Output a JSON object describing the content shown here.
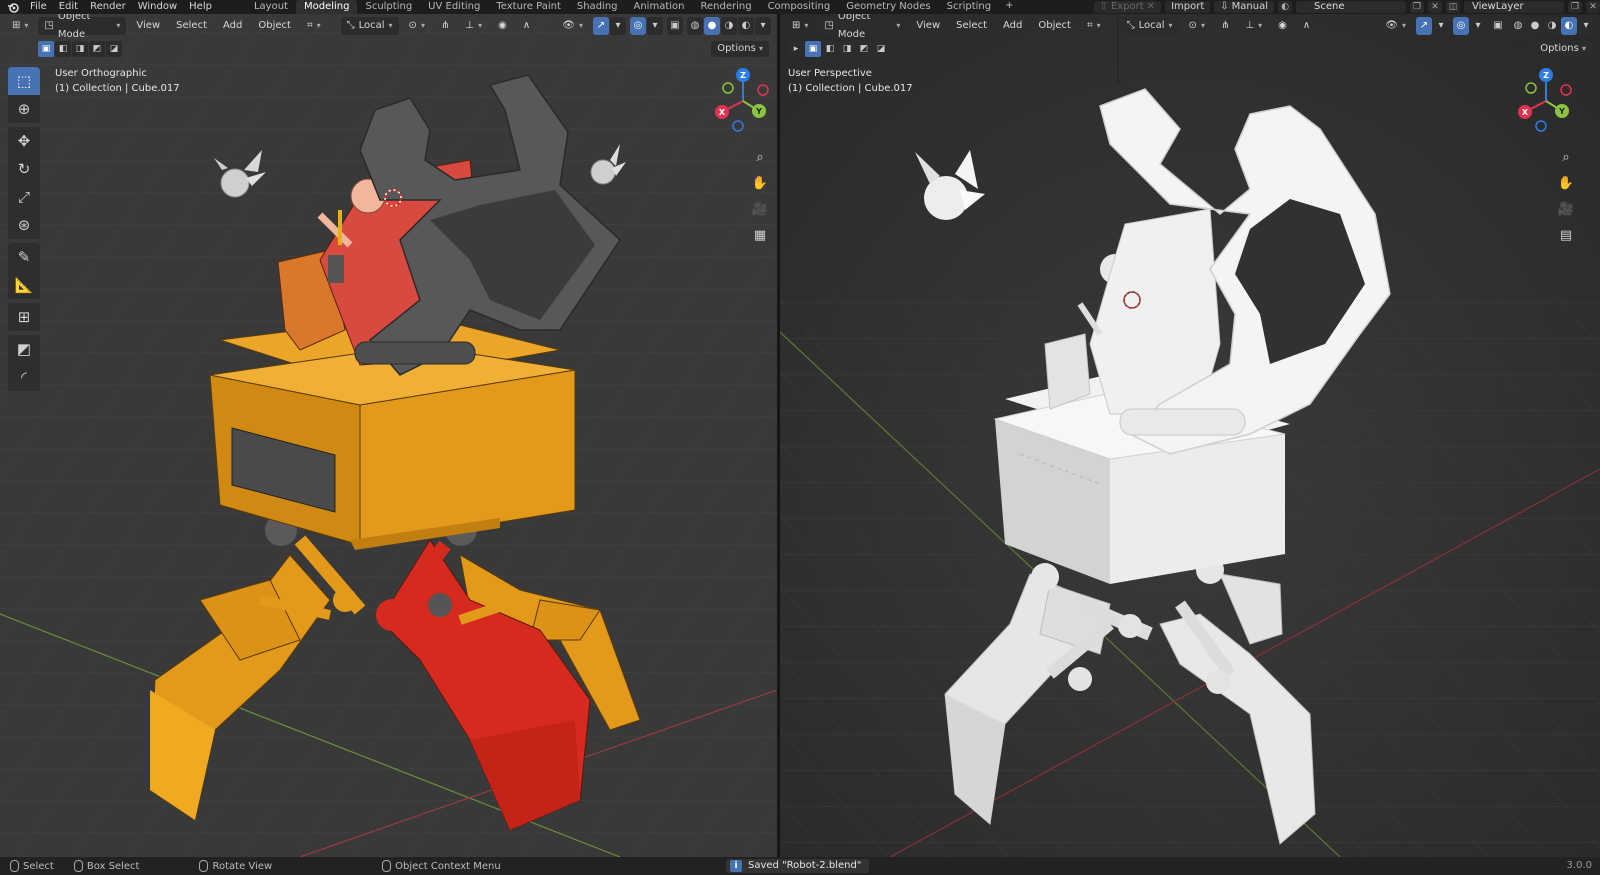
{
  "menu": {
    "file": "File",
    "edit": "Edit",
    "render": "Render",
    "window": "Window",
    "help": "Help"
  },
  "workspace_tabs": [
    {
      "label": "Layout"
    },
    {
      "label": "Modeling"
    },
    {
      "label": "Sculpting"
    },
    {
      "label": "UV Editing"
    },
    {
      "label": "Texture Paint"
    },
    {
      "label": "Shading"
    },
    {
      "label": "Animation"
    },
    {
      "label": "Rendering"
    },
    {
      "label": "Compositing"
    },
    {
      "label": "Geometry Nodes"
    },
    {
      "label": "Scripting"
    }
  ],
  "active_tab": "Modeling",
  "top_right": {
    "export_label": "Export",
    "import_label": "Import",
    "manual_label": "Manual",
    "scene_name": "Scene",
    "view_layer": "ViewLayer"
  },
  "viewport_left": {
    "mode": "Object Mode",
    "menu": [
      "View",
      "Select",
      "Add",
      "Object"
    ],
    "orientation": "Local",
    "options": "Options",
    "view_name": "User Orthographic",
    "collection_info": "(1) Collection | Cube.017",
    "gizmo_axes": {
      "x": "X",
      "y": "Y",
      "z": "Z"
    }
  },
  "viewport_right": {
    "mode": "Object Mode",
    "menu": [
      "View",
      "Select",
      "Add",
      "Object"
    ],
    "orientation": "Local",
    "options": "Options",
    "view_name": "User Perspective",
    "collection_info": "(1) Collection | Cube.017",
    "gizmo_axes": {
      "x": "X",
      "y": "Y",
      "z": "Z"
    }
  },
  "toolbar_tools": [
    "select-box",
    "cursor",
    "move",
    "rotate",
    "scale",
    "transform",
    "annotate",
    "measure",
    "add-cube",
    "extrude",
    "bevel"
  ],
  "status_bar": {
    "select": "Select",
    "box_select": "Box Select",
    "rotate_view": "Rotate View",
    "context_menu": "Object Context Menu",
    "saved_message": "Saved \"Robot-2.blend\"",
    "version": "3.0.0"
  },
  "colors": {
    "accent": "#4772b3",
    "body_orange": "#e39a1a",
    "seat_red": "#d84a3f",
    "leg_red": "#d62a1e",
    "dark_grey": "#4d4d4d",
    "clay_white": "#e8e8ea",
    "axis_x": "#e3344f",
    "axis_y": "#8bc53f",
    "axis_z": "#2d7de3"
  }
}
